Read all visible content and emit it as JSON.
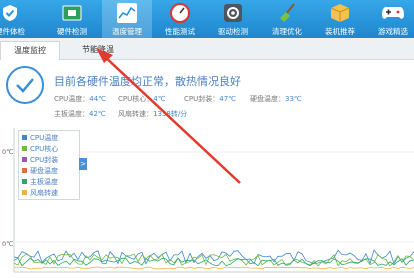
{
  "toolbar": {
    "items": [
      {
        "label": "硬件体检",
        "icon": "shield-check-icon"
      },
      {
        "label": "硬件检测",
        "icon": "chip-icon"
      },
      {
        "label": "温度管理",
        "icon": "thermometer-icon",
        "active": true
      },
      {
        "label": "性能测试",
        "icon": "speedometer-icon"
      },
      {
        "label": "驱动检测",
        "icon": "gear-icon"
      },
      {
        "label": "清理优化",
        "icon": "broom-icon"
      },
      {
        "label": "装机推荐",
        "icon": "box-icon"
      },
      {
        "label": "游戏精选",
        "icon": "gamepad-icon"
      }
    ],
    "colors": {
      "bg_top": "#36a7e8",
      "bg_bottom": "#1f86cf"
    }
  },
  "tabs": [
    {
      "label": "温度监控",
      "active": true
    },
    {
      "label": "节能降温",
      "active": false
    }
  ],
  "status": {
    "headline": "目前各硬件温度均正常，散热情况良好",
    "cpu_temp_label": "CPU温度：",
    "cpu_temp": "44℃",
    "cpu_core_label": "CPU核心：",
    "cpu_core": "4℃",
    "cpu_package_label": "CPU封装：",
    "cpu_package": "47℃",
    "disk_temp_label": "硬盘温度：",
    "disk_temp": "33℃",
    "board_temp_label": "主板温度：",
    "board_temp": "42℃",
    "fan_label": "风扇转速：",
    "fan": "1338转/分"
  },
  "legend": {
    "items": [
      {
        "label": "CPU温度",
        "color": "#3f86d2"
      },
      {
        "label": "CPU核心",
        "color": "#6bbf3a"
      },
      {
        "label": "CPU封装",
        "color": "#9b59b6"
      },
      {
        "label": "硬盘温度",
        "color": "#e36c3a"
      },
      {
        "label": "主板温度",
        "color": "#2ca66b"
      },
      {
        "label": "风扇转速",
        "color": "#f0b33a"
      }
    ],
    "toggle": ">"
  },
  "axis": {
    "y_top": "0℃",
    "y_bottom": "0℃"
  },
  "annotation": {
    "color": "#e23b2e"
  }
}
